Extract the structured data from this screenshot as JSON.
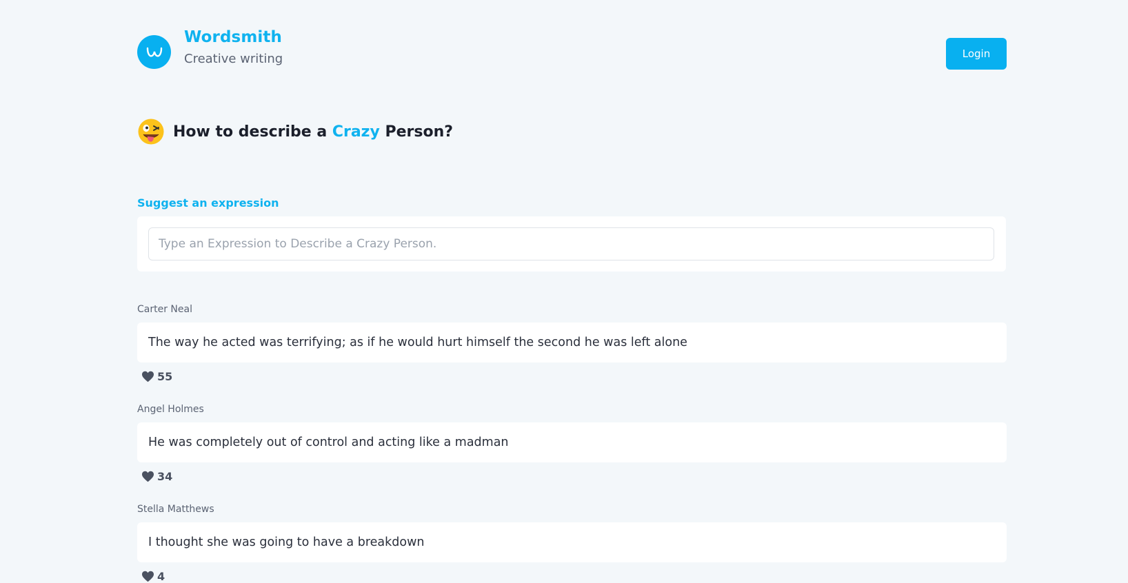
{
  "brand": {
    "name": "Wordsmith",
    "tagline": "Creative writing",
    "logo_letter": "w"
  },
  "header": {
    "login_label": "Login"
  },
  "page": {
    "title_prefix": "How to describe a ",
    "title_accent": "Crazy",
    "title_suffix": " Person?",
    "emoji": "zany-face-emoji"
  },
  "suggest": {
    "label": "Suggest an expression",
    "placeholder": "Type an Expression to Describe a Crazy Person."
  },
  "posts": [
    {
      "author": "Carter Neal",
      "text": "The way he acted was terrifying; as if he would hurt himself the second he was left alone",
      "likes": "55"
    },
    {
      "author": "Angel Holmes",
      "text": "He was completely out of control and acting like a madman",
      "likes": "34"
    },
    {
      "author": "Stella Matthews",
      "text": "I thought she was going to have a breakdown",
      "likes": "4"
    }
  ],
  "colors": {
    "accent": "#08b0f0",
    "background": "#f3f7fa",
    "card": "#ffffff",
    "heart": "#4a5160"
  }
}
